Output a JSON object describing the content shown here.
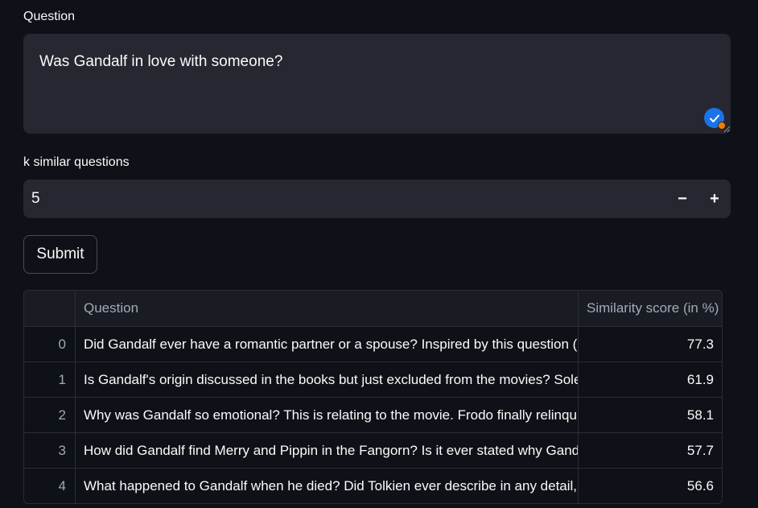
{
  "question": {
    "label": "Question",
    "value": "Was Gandalf in love with someone?"
  },
  "k_input": {
    "label": "k similar questions",
    "value": "5",
    "decrement_label": "−",
    "increment_label": "+"
  },
  "submit": {
    "label": "Submit"
  },
  "table": {
    "columns": [
      "",
      "Question",
      "Similarity score (in %)"
    ],
    "rows": [
      {
        "index": "0",
        "question": "Did Gandalf ever have a romantic partner or a spouse? Inspired by this question (abo",
        "score": "77.3"
      },
      {
        "index": "1",
        "question": "Is Gandalf's origin discussed in the books but just excluded from the movies? Solely f",
        "score": "61.9"
      },
      {
        "index": "2",
        "question": "Why was Gandalf so emotional? This is relating to the movie. Frodo finally relinquishe",
        "score": "58.1"
      },
      {
        "index": "3",
        "question": "How did Gandalf find Merry and Pippin in the Fangorn? Is it ever stated why Gandalf e",
        "score": "57.7"
      },
      {
        "index": "4",
        "question": "What happened to Gandalf when he died? Did Tolkien ever describe in any detail, oth",
        "score": "56.6"
      }
    ]
  },
  "icons": {
    "grammar": "grammar-check-icon",
    "resize": "resize-handle-icon"
  },
  "colors": {
    "background": "#0e1117",
    "input_background": "#262730",
    "accent_blue": "#1a73e8",
    "accent_orange": "#f57c00"
  }
}
